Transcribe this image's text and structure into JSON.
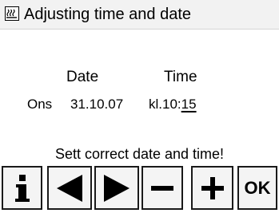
{
  "header": {
    "icon": "heating-icon",
    "title": "Adjusting time and date"
  },
  "labels": {
    "date": "Date",
    "time": "Time"
  },
  "values": {
    "weekday": "Ons",
    "date": "31.10.07",
    "time_prefix": "kl.",
    "hours": "10",
    "separator": ":",
    "minutes": "15"
  },
  "message": "Sett correct date and time!",
  "toolbar": {
    "info_icon": "info-icon",
    "left_icon": "arrow-left-icon",
    "right_icon": "arrow-right-icon",
    "minus_icon": "minus-icon",
    "plus_icon": "plus-icon",
    "ok_label": "OK"
  }
}
